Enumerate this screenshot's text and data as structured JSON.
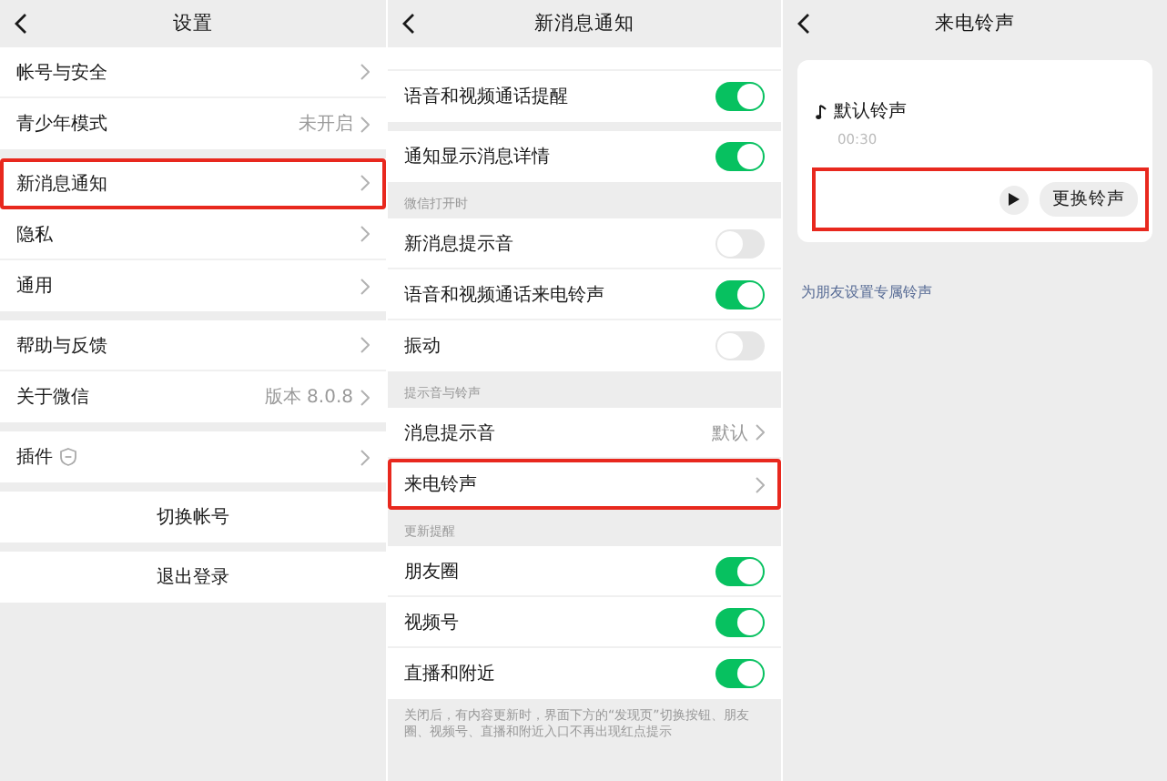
{
  "screens": [
    {
      "title": "设置",
      "blocks": [
        {
          "kind": "group",
          "items": [
            {
              "kind": "chevron",
              "label": "帐号与安全",
              "highlighted": false
            },
            {
              "kind": "chevron",
              "label": "青少年模式",
              "value": "未开启",
              "highlighted": false
            }
          ]
        },
        {
          "kind": "group",
          "items": [
            {
              "kind": "chevron",
              "label": "新消息通知",
              "highlighted": true
            },
            {
              "kind": "chevron",
              "label": "隐私",
              "highlighted": false
            },
            {
              "kind": "chevron",
              "label": "通用",
              "highlighted": false
            }
          ]
        },
        {
          "kind": "group",
          "items": [
            {
              "kind": "chevron",
              "label": "帮助与反馈",
              "highlighted": false
            },
            {
              "kind": "chevron",
              "label": "关于微信",
              "value": "版本 8.0.8",
              "highlighted": false
            }
          ]
        },
        {
          "kind": "group",
          "items": [
            {
              "kind": "badged",
              "label": "插件",
              "highlighted": false
            }
          ]
        },
        {
          "kind": "group",
          "items": [
            {
              "kind": "action",
              "label": "切换帐号",
              "highlighted": false
            }
          ]
        },
        {
          "kind": "group",
          "items": [
            {
              "kind": "action",
              "label": "退出登录",
              "highlighted": false
            }
          ]
        }
      ]
    },
    {
      "title": "新消息通知",
      "blocks": [
        {
          "kind": "group",
          "items": [
            {
              "kind": "toggle",
              "label": "语音和视频通话提醒",
              "on": true,
              "highlighted": false
            }
          ]
        },
        {
          "kind": "group",
          "items": [
            {
              "kind": "toggle",
              "label": "通知显示消息详情",
              "on": true,
              "highlighted": false
            }
          ]
        },
        {
          "kind": "section",
          "label": "微信打开时"
        },
        {
          "kind": "group",
          "items": [
            {
              "kind": "toggle",
              "label": "新消息提示音",
              "on": false,
              "highlighted": false
            },
            {
              "kind": "toggle",
              "label": "语音和视频通话来电铃声",
              "on": true,
              "highlighted": false
            },
            {
              "kind": "toggle",
              "label": "振动",
              "on": false,
              "highlighted": false
            }
          ]
        },
        {
          "kind": "section",
          "label": "提示音与铃声"
        },
        {
          "kind": "group",
          "items": [
            {
              "kind": "chevron",
              "label": "消息提示音",
              "value": "默认",
              "highlighted": false
            },
            {
              "kind": "chevron",
              "label": "来电铃声",
              "highlighted": true
            }
          ]
        },
        {
          "kind": "section",
          "label": "更新提醒"
        },
        {
          "kind": "group",
          "items": [
            {
              "kind": "toggle",
              "label": "朋友圈",
              "on": true,
              "highlighted": false
            },
            {
              "kind": "toggle",
              "label": "视频号",
              "on": true,
              "highlighted": false
            },
            {
              "kind": "toggle",
              "label": "直播和附近",
              "on": true,
              "highlighted": false
            }
          ]
        },
        {
          "kind": "note",
          "label": "关闭后，有内容更新时，界面下方的“发现页”切换按钮、朋友圈、视频号、直播和附近入口不再出现红点提示"
        }
      ]
    },
    {
      "title": "来电铃声",
      "blocks": [
        {
          "kind": "card",
          "name": "默认铃声",
          "duration": "00:30",
          "button": "更换铃声",
          "highlighted": true
        },
        {
          "kind": "link",
          "label": "为朋友设置专属铃声"
        }
      ]
    }
  ]
}
